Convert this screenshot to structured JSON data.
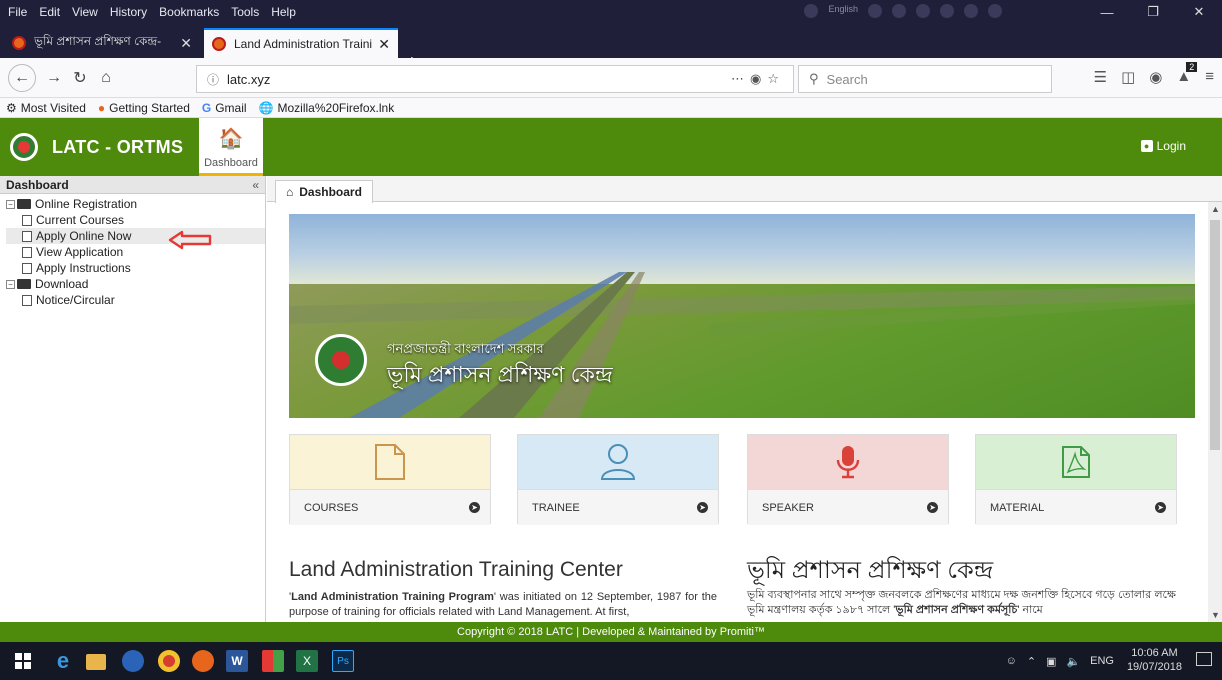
{
  "browser": {
    "menu": [
      "File",
      "Edit",
      "View",
      "History",
      "Bookmarks",
      "Tools",
      "Help"
    ],
    "tray_language": "English",
    "tabs": [
      {
        "title": "ভূমি প্রশাসন প্রশিক্ষণ কেন্দ্র-"
      },
      {
        "title": "Land Administration Training C"
      }
    ],
    "url": "latc.xyz",
    "search_placeholder": "Search",
    "extension_badge": "2",
    "bookmarks": [
      "Most Visited",
      "Getting Started",
      "Gmail",
      "Mozilla%20Firefox.lnk"
    ]
  },
  "app": {
    "brand": "LATC - ORTMS",
    "dashboard_label": "Dashboard",
    "login_label": "Login"
  },
  "sidebar": {
    "title": "Dashboard",
    "groups": [
      {
        "label": "Online Registration",
        "items": [
          "Current Courses",
          "Apply Online Now",
          "View Application",
          "Apply Instructions"
        ]
      },
      {
        "label": "Download",
        "items": [
          "Notice/Circular"
        ]
      }
    ],
    "selected_item": "Apply Online Now"
  },
  "content": {
    "tab_label": "Dashboard",
    "banner": {
      "line1": "গনপ্রজাতন্ত্রী বাংলাদেশ সরকার",
      "line2": "ভূমি প্রশাসন প্রশিক্ষণ কেন্দ্র"
    },
    "cards": [
      {
        "label": "COURSES",
        "bg": "#fbf3d6",
        "icon_color": "#c9954f"
      },
      {
        "label": "TRAINEE",
        "bg": "#d7e9f5",
        "icon_color": "#4a8fb8"
      },
      {
        "label": "SPEAKER",
        "bg": "#f3d6d6",
        "icon_color": "#d9423a"
      },
      {
        "label": "MATERIAL",
        "bg": "#d9efd4",
        "icon_color": "#3f9b45"
      }
    ],
    "title_en": "Land Administration Training Center",
    "para_en_bold": "Land Administration Training Program",
    "para_en_pre": "'",
    "para_en_post": "' was initiated on 12 September, 1987 for the purpose of training for officials related with Land Management. At first,",
    "title_bn": "ভূমি প্রশাসন প্রশিক্ষণ কেন্দ্র",
    "para_bn_pre": "ভূমি ব্যবস্থাপনার সাথে সম্পৃক্ত জনবলকে প্রশিক্ষণের মাধ্যমে দক্ষ জনশক্তি হিসেবে গড়ে তোলার লক্ষে ভূমি মন্ত্রণালয় কর্তৃক ১৯৮৭ সালে '",
    "para_bn_bold": "ভূমি প্রশাসন প্রশিক্ষণ কর্মসূচি",
    "para_bn_post": "' নামে"
  },
  "footer": {
    "copyright": "Copyright © 2018 LATC | Developed & Maintained by Promiti™"
  },
  "taskbar": {
    "lang": "ENG",
    "time": "10:06 AM",
    "date": "19/07/2018"
  },
  "colors": {
    "header_green": "#4e8a0c",
    "arrow_red": "#e53935"
  }
}
